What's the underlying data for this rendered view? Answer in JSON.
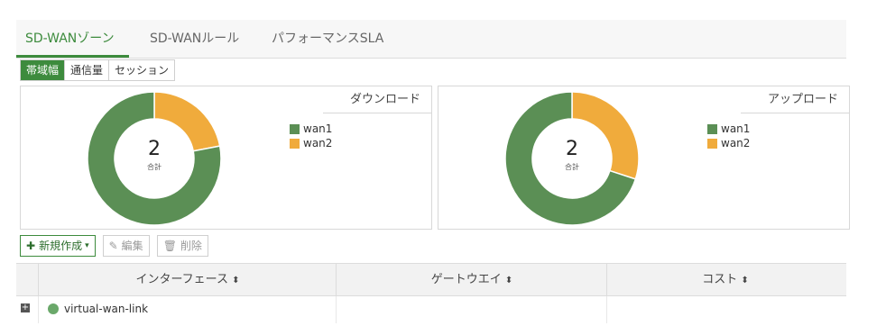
{
  "tabs": [
    {
      "label": "SD-WANゾーン"
    },
    {
      "label": "SD-WANルール"
    },
    {
      "label": "パフォーマンスSLA"
    }
  ],
  "subtabs": [
    {
      "label": "帯域幅"
    },
    {
      "label": "通信量"
    },
    {
      "label": "セッション"
    }
  ],
  "charts": [
    {
      "title": "ダウンロード",
      "total": "2",
      "total_label": "合計",
      "legend": [
        {
          "name": "wan1",
          "color": "#5b8f55"
        },
        {
          "name": "wan2",
          "color": "#f0ab3c"
        }
      ]
    },
    {
      "title": "アップロード",
      "total": "2",
      "total_label": "合計",
      "legend": [
        {
          "name": "wan1",
          "color": "#5b8f55"
        },
        {
          "name": "wan2",
          "color": "#f0ab3c"
        }
      ]
    }
  ],
  "chart_data": [
    {
      "type": "pie",
      "title": "ダウンロード",
      "categories": [
        "wan1",
        "wan2"
      ],
      "values": [
        78,
        22
      ]
    },
    {
      "type": "pie",
      "title": "アップロード",
      "categories": [
        "wan1",
        "wan2"
      ],
      "values": [
        70,
        30
      ]
    }
  ],
  "toolbar": {
    "create_label": "新規作成",
    "edit_label": "編集",
    "delete_label": "削除"
  },
  "table": {
    "columns": [
      {
        "label": "インターフェース"
      },
      {
        "label": "ゲートウエイ"
      },
      {
        "label": "コスト"
      }
    ],
    "rows": [
      {
        "interface": "virtual-wan-link"
      }
    ]
  }
}
